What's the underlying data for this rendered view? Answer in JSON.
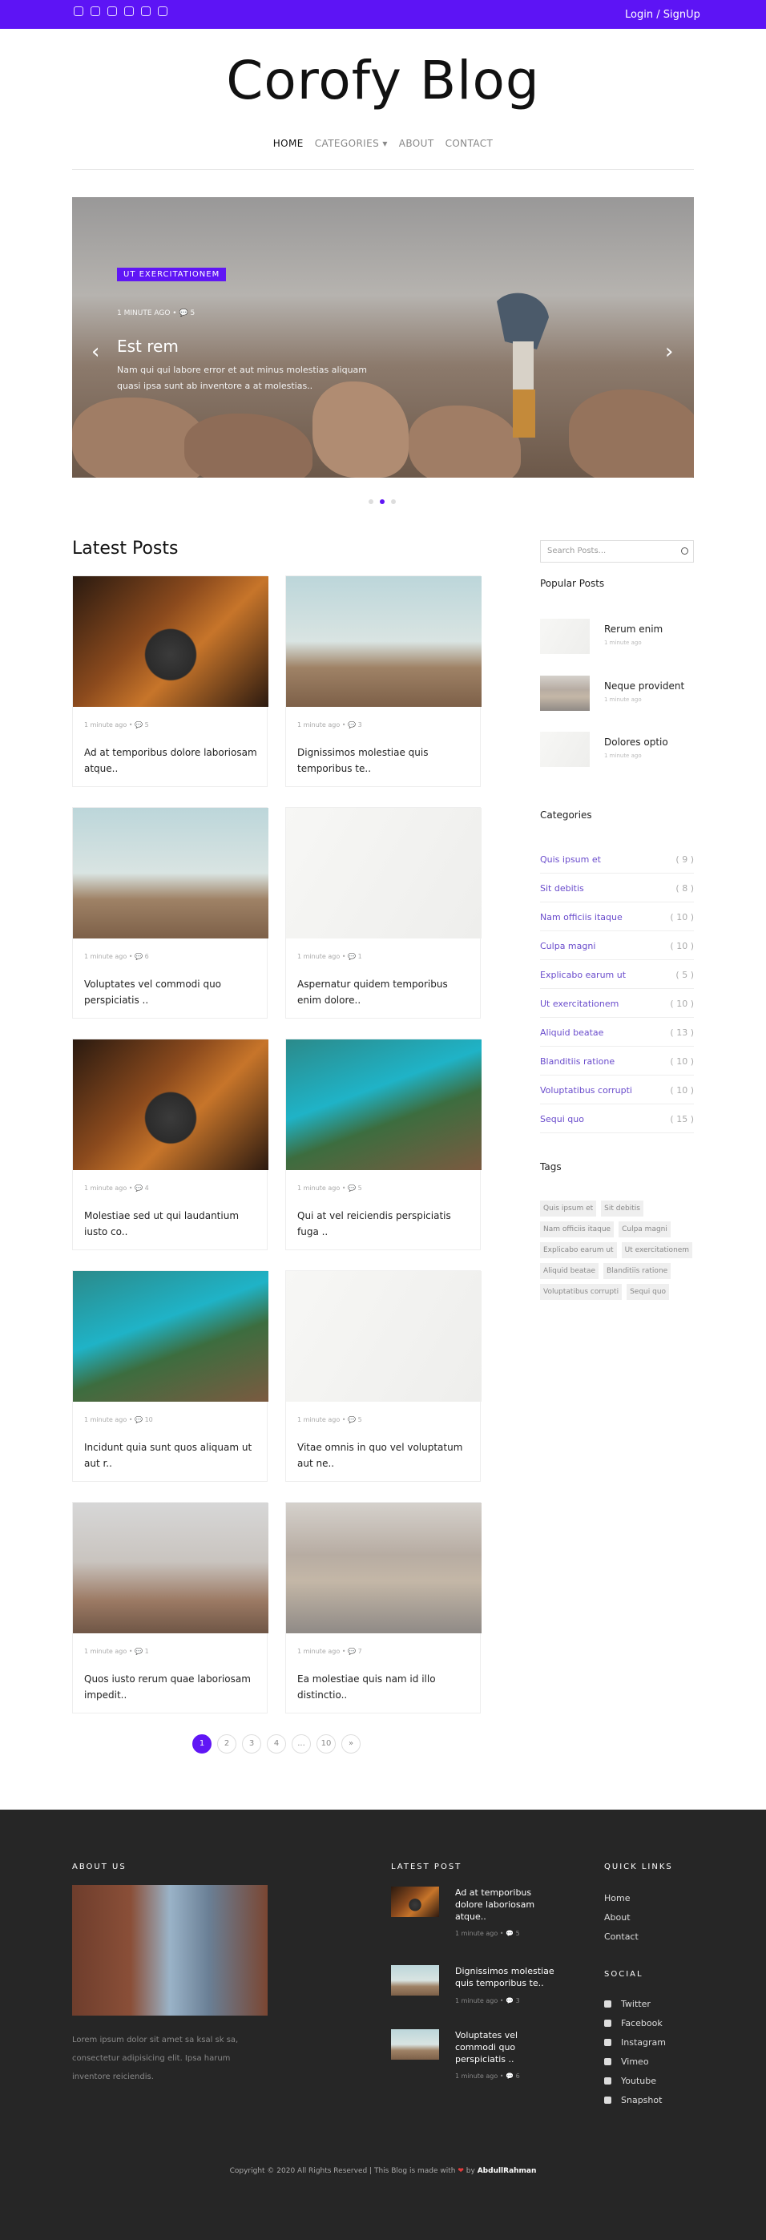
{
  "header": {
    "login": "Login / SignUp",
    "brand": "Corofy Blog",
    "social_icons": [
      "youtube-icon",
      "instagram-icon",
      "vimeo-icon",
      "twitter-icon",
      "facebook-icon",
      "instagram-icon"
    ]
  },
  "nav": {
    "home": "HOME",
    "categories": "CATEGORIES ▾",
    "about": "ABOUT",
    "contact": "CONTACT"
  },
  "hero": {
    "badge": "UT EXERCITATIONEM",
    "meta": "1 MINUTE AGO  •  💬 5",
    "title": "Est rem",
    "excerpt": "Nam qui qui labore error et aut minus molestias aliquam quasi ipsa sunt ab inventore a at molestias..",
    "prev": "‹",
    "next": "›"
  },
  "latest_heading": "Latest Posts",
  "posts": [
    {
      "meta": "1 minute ago  •  💬 5",
      "title": "Ad at temporibus dolore laboriosam atque.."
    },
    {
      "meta": "1 minute ago  •  💬 3",
      "title": "Dignissimos molestiae quis temporibus te.."
    },
    {
      "meta": "1 minute ago  •  💬 6",
      "title": "Voluptates vel commodi quo perspiciatis .."
    },
    {
      "meta": "1 minute ago  •  💬 1",
      "title": "Aspernatur quidem temporibus enim dolore.."
    },
    {
      "meta": "1 minute ago  •  💬 4",
      "title": "Molestiae sed ut qui laudantium iusto co.."
    },
    {
      "meta": "1 minute ago  •  💬 5",
      "title": "Qui at vel reiciendis perspiciatis fuga .."
    },
    {
      "meta": "1 minute ago  •  💬 10",
      "title": "Incidunt quia sunt quos aliquam ut aut r.."
    },
    {
      "meta": "1 minute ago  •  💬 5",
      "title": "Vitae omnis in quo vel voluptatum aut ne.."
    },
    {
      "meta": "1 minute ago  •  💬 1",
      "title": "Quos iusto rerum quae laboriosam impedit.."
    },
    {
      "meta": "1 minute ago  •  💬 7",
      "title": "Ea molestiae quis nam id illo distinctio.."
    }
  ],
  "pagination": [
    "1",
    "2",
    "3",
    "4",
    "...",
    "10",
    "»"
  ],
  "sidebar": {
    "search_placeholder": "Search Posts...",
    "popular_heading": "Popular Posts",
    "popular": [
      {
        "title": "Rerum enim",
        "meta": "1 minute ago"
      },
      {
        "title": "Neque provident",
        "meta": "1 minute ago"
      },
      {
        "title": "Dolores optio",
        "meta": "1 minute ago"
      }
    ],
    "categories_heading": "Categories",
    "categories": [
      {
        "name": "Quis ipsum et",
        "count": "( 9 )"
      },
      {
        "name": "Sit debitis",
        "count": "( 8 )"
      },
      {
        "name": "Nam officiis itaque",
        "count": "( 10 )"
      },
      {
        "name": "Culpa magni",
        "count": "( 10 )"
      },
      {
        "name": "Explicabo earum ut",
        "count": "( 5 )"
      },
      {
        "name": "Ut exercitationem",
        "count": "( 10 )"
      },
      {
        "name": "Aliquid beatae",
        "count": "( 13 )"
      },
      {
        "name": "Blanditiis ratione",
        "count": "( 10 )"
      },
      {
        "name": "Voluptatibus corrupti",
        "count": "( 10 )"
      },
      {
        "name": "Sequi quo",
        "count": "( 15 )"
      }
    ],
    "tags_heading": "Tags",
    "tags": [
      "Quis ipsum et",
      "Sit debitis",
      "Nam officiis itaque",
      "Culpa magni",
      "Explicabo earum ut",
      "Ut exercitationem",
      "Aliquid beatae",
      "Blanditiis ratione",
      "Voluptatibus corrupti",
      "Sequi quo"
    ]
  },
  "footer": {
    "about_heading": "ABOUT US",
    "about_text": "Lorem ipsum dolor sit amet sa ksal sk sa, consectetur adipisicing elit. Ipsa harum inventore reiciendis.",
    "latest_heading": "LATEST POST",
    "latest": [
      {
        "title": "Ad at temporibus dolore laboriosam atque..",
        "meta": "1 minute ago  •  💬 5"
      },
      {
        "title": "Dignissimos molestiae quis temporibus te..",
        "meta": "1 minute ago  •  💬 3"
      },
      {
        "title": "Voluptates vel commodi quo perspiciatis ..",
        "meta": "1 minute ago  •  💬 6"
      }
    ],
    "quick_heading": "QUICK LINKS",
    "quick": [
      "Home",
      "About",
      "Contact"
    ],
    "social_heading": "SOCIAL",
    "social": [
      "Twitter",
      "Facebook",
      "Instagram",
      "Vimeo",
      "Youtube",
      "Snapshot"
    ],
    "copyright_prefix": "Copyright © 2020 All Rights Reserved | This Blog is made with",
    "copyright_by": "by",
    "author": "AbdullRahman"
  },
  "colors": {
    "accent": "#5d14f5",
    "footer": "#262626"
  }
}
